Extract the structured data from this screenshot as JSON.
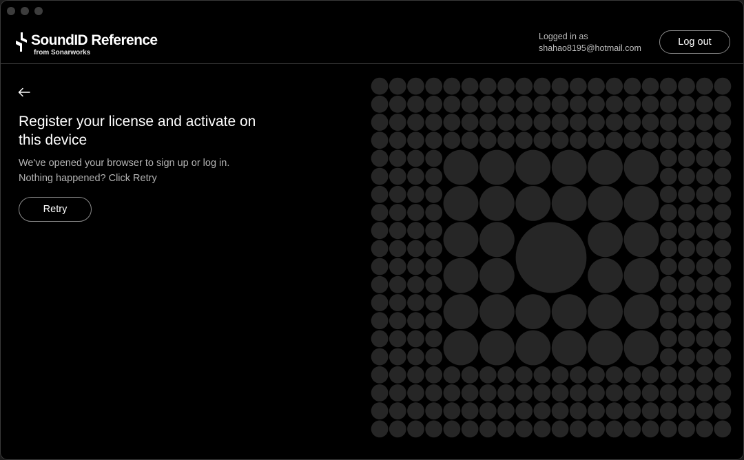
{
  "header": {
    "brand": "SoundID Reference",
    "brand_sub": "from Sonarworks",
    "logged_in_label": "Logged in as",
    "user_email": "shahao8195@hotmail.com",
    "logout_label": "Log out"
  },
  "main": {
    "heading": "Register your license and activate on this device",
    "desc_line1": "We've opened your browser to sign up or log in.",
    "desc_line2": "Nothing happened? Click Retry",
    "retry_label": "Retry"
  },
  "colors": {
    "background": "#000000",
    "dot": "#262626",
    "border": "#3a3a3a"
  }
}
